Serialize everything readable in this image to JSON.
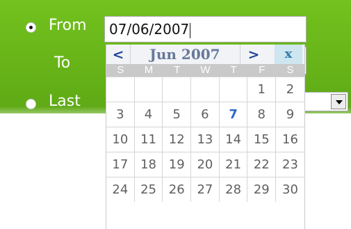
{
  "filter": {
    "from_label": "From",
    "to_label": "To",
    "last_label": "Last",
    "from_value": "07/06/2007"
  },
  "calendar": {
    "prev": "<",
    "title": "Jun 2007",
    "next": ">",
    "close": "x",
    "weekdays": [
      "S",
      "M",
      "T",
      "W",
      "T",
      "F",
      "S"
    ],
    "weeks": [
      [
        "",
        "",
        "",
        "",
        "",
        "1",
        "2"
      ],
      [
        "3",
        "4",
        "5",
        "6",
        "7",
        "8",
        "9"
      ],
      [
        "10",
        "11",
        "12",
        "13",
        "14",
        "15",
        "16"
      ],
      [
        "17",
        "18",
        "19",
        "20",
        "21",
        "22",
        "23"
      ],
      [
        "24",
        "25",
        "26",
        "27",
        "28",
        "29",
        "30"
      ]
    ],
    "selected_day": "7"
  },
  "colors": {
    "panel_green": "#5ea915",
    "header_bg": "#f1f3f6",
    "weekday_bg": "#c9c9c9",
    "today_blue": "#2f68c8"
  },
  "icons": {
    "dropdown": "chevron-down-icon"
  }
}
